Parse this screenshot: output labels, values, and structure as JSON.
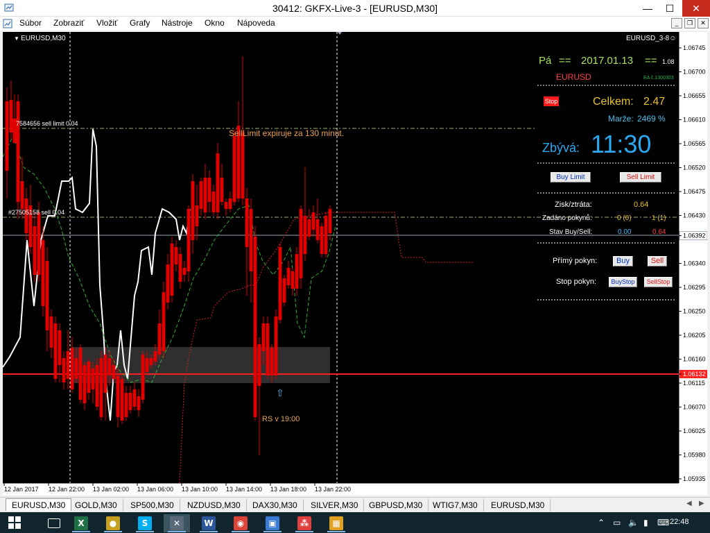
{
  "window": {
    "title": "30412: GKFX-Live-3 - [EURUSD,M30]",
    "minimize_glyph": "—",
    "maximize_glyph": "☐",
    "close_glyph": "✕"
  },
  "menu": [
    "Súbor",
    "Zobraziť",
    "Vložiť",
    "Grafy",
    "Nástroje",
    "Okno",
    "Nápoveda"
  ],
  "chart": {
    "symbol_label": "EURUSD,M30",
    "ea_label": "EURUSD_3-8",
    "smiley_glyph": "☺",
    "sell_limit_line_label": "7584656 sell limit 0.04",
    "sell_line_label": "#27505158 sell 0.04",
    "expire_text": "SellLimit expiruje za 130 minút.",
    "rs_text": "RS v 19:00",
    "current_price_tag": "1.06392",
    "red_line_price_tag": "1.06132",
    "price_axis": [
      "1.06745",
      "1.06700",
      "1.06655",
      "1.06610",
      "1.06565",
      "1.06520",
      "1.06475",
      "1.06430",
      "1.06392",
      "1.06340",
      "1.06295",
      "1.06250",
      "1.06205",
      "1.06160",
      "1.06132",
      "1.06115",
      "1.06070",
      "1.06025",
      "1.05980",
      "1.05935"
    ],
    "time_axis": [
      "12 Jan 2017",
      "12 Jan 22:00",
      "13 Jan 02:00",
      "13 Jan 06:00",
      "13 Jan 10:00",
      "13 Jan 14:00",
      "13 Jan 18:00",
      "13 Jan 22:00"
    ],
    "colors": {
      "background": "#000000",
      "bull": "#00d000",
      "bear": "#e00000",
      "grid": "#ffffff",
      "red_line": "#ff2020",
      "ask_line": "#9aa6b8",
      "panel_green": "#a8e060",
      "panel_gold": "#e8c030",
      "panel_cyan": "#4ab8f0",
      "panel_red": "#ff4040"
    }
  },
  "panel": {
    "day": "Pá",
    "eq1": "==",
    "date": "2017.01.13",
    "eq2": "==",
    "version": "1.08",
    "symbol": "EURUSD",
    "ea_number": "EA č.1300303",
    "stop_button": "Stop",
    "celkem_label": "Celkem:",
    "celkem_value": "2.47",
    "marze_label": "Marže:",
    "marze_value": "2469 %",
    "zbyva_label": "Zbývá:",
    "zbyva_time": "11:30",
    "buy_limit": "Buy Limit",
    "sell_limit": "Sell Limit",
    "zisk_label": "Zisk/ztráta:",
    "zisk_value": "0.64",
    "zadano_label": "Zadáno pokynů:",
    "zadano_buy": "0 (0)",
    "zadano_sell": "1 (1)",
    "stav_label": "Stav Buy/Sell:",
    "stav_buy": "0.00",
    "stav_sell": "0.64",
    "primy_label": "Přímý pokyn:",
    "buy": "Buy",
    "sell": "Sell",
    "stop_label": "Stop pokyn:",
    "buystop": "BuyStop",
    "sellstop": "SellStop"
  },
  "tabs": [
    "EURUSD,M30",
    "GOLD,M30",
    "SP500,M30",
    "NZDUSD,M30",
    "DAX30,M30",
    "SILVER,M30",
    "GBPUSD,M30",
    "WTIG7,M30",
    "EURUSD,M30"
  ],
  "taskbar": {
    "clock": "22:48",
    "apps": [
      {
        "icon": "excel-icon",
        "glyph": "X",
        "color": "#1e7145"
      },
      {
        "icon": "globe-icon",
        "glyph": "●",
        "color": "#c8a020"
      },
      {
        "icon": "skype-icon",
        "glyph": "S",
        "color": "#00aff0"
      },
      {
        "icon": "metatrader-icon",
        "glyph": "✕",
        "color": "#5a6a78"
      },
      {
        "icon": "word-icon",
        "glyph": "W",
        "color": "#2b579a"
      },
      {
        "icon": "chrome-icon",
        "glyph": "◉",
        "color": "#db4437"
      },
      {
        "icon": "photos-icon",
        "glyph": "▣",
        "color": "#3a7bd5"
      },
      {
        "icon": "dots-icon",
        "glyph": "⁂",
        "color": "#e04040"
      },
      {
        "icon": "store-icon",
        "glyph": "▦",
        "color": "#e0a020"
      }
    ]
  }
}
